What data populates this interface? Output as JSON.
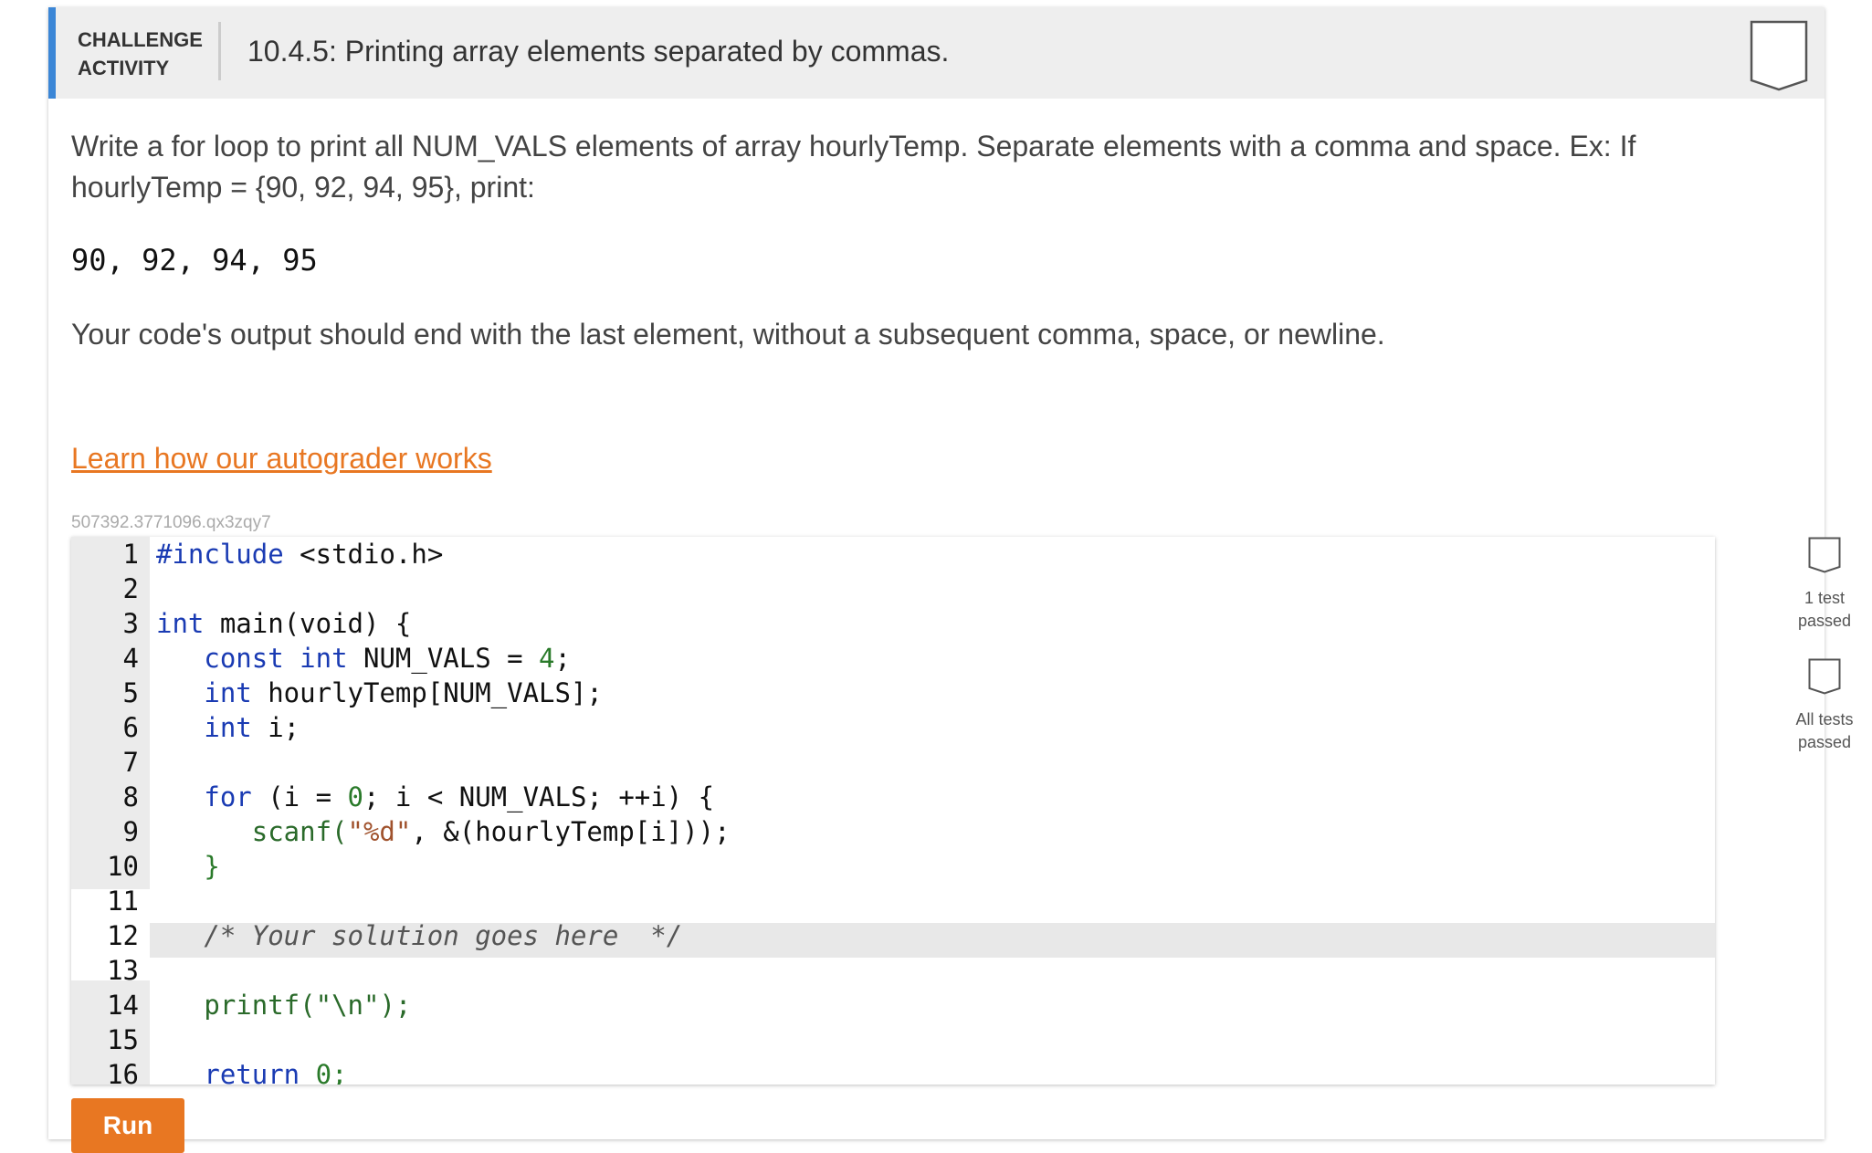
{
  "header": {
    "label_line1": "CHALLENGE",
    "label_line2": "ACTIVITY",
    "title": "10.4.5: Printing array elements separated by commas."
  },
  "prompt": {
    "text": "Write a for loop to print all NUM_VALS elements of array hourlyTemp. Separate elements with a comma and space. Ex: If hourlyTemp = {90, 92, 94, 95}, print:",
    "example_output": "90, 92, 94, 95",
    "note": "Your code's output should end with the last element, without a subsequent comma, space, or newline."
  },
  "learn_link": "Learn how our autograder works",
  "activity_id": "507392.3771096.qx3zqy7",
  "editor": {
    "line_numbers": [
      "1",
      "2",
      "3",
      "4",
      "5",
      "6",
      "7",
      "8",
      "9",
      "10",
      "11",
      "12",
      "13",
      "14",
      "15",
      "16"
    ],
    "l1a": "#include",
    "l1b": " <stdio.h>",
    "l3a": "int",
    "l3b": " main(void) {",
    "l4a": "   const",
    "l4b": " int",
    "l4c": " NUM_VALS = ",
    "l4d": "4",
    "l4e": ";",
    "l5a": "   int",
    "l5b": " hourlyTemp[NUM_VALS];",
    "l6a": "   int",
    "l6b": " i;",
    "l8a": "   for",
    "l8b": " (i = ",
    "l8c": "0",
    "l8d": "; i < NUM_VALS; ++i) {",
    "l9a": "      scanf(",
    "l9b": "\"%d\"",
    "l9c": ", &(hourlyTemp[i]));",
    "l10": "   }",
    "l12": "   /* Your solution goes here  */",
    "l14a": "   printf(",
    "l14b": "\"\\n\"",
    "l14c": ");",
    "l16a": "   return",
    "l16b": " 0;"
  },
  "tests": {
    "one_line1": "1 test",
    "one_line2": "passed",
    "all_line1": "All tests",
    "all_line2": "passed"
  },
  "run_button": "Run",
  "colors": {
    "accent_blue": "#3b86d6",
    "accent_orange": "#e87722",
    "header_bg": "#eeeeee"
  }
}
